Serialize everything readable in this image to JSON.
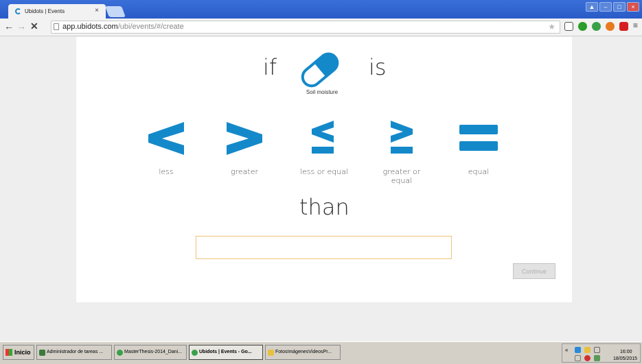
{
  "browser": {
    "tab_title": "Ubidots | Events",
    "tab_close": "×",
    "url_host": "app.ubidots.com",
    "url_path": "/ubi/events/#/create"
  },
  "event": {
    "if_word": "if",
    "is_word": "is",
    "than_word": "than",
    "sensor_label": "Soil moisture",
    "operators": [
      {
        "label": "less",
        "icon": "less-than-icon"
      },
      {
        "label": "greater",
        "icon": "greater-than-icon"
      },
      {
        "label": "less or equal",
        "icon": "less-or-equal-icon"
      },
      {
        "label": "greater or equal",
        "icon": "greater-or-equal-icon"
      },
      {
        "label": "equal",
        "icon": "equal-icon"
      }
    ],
    "value_input": "",
    "continue_label": "Continue"
  },
  "taskbar": {
    "start_label": "Inicio",
    "items": [
      "Administrador de tareas ...",
      "MasterThesis-2014_Dani...",
      "Ubidots | Events - Go...",
      "FotosImágenesVideosPr..."
    ],
    "clock_time": "16:00",
    "clock_date": "18/05/2015"
  },
  "colors": {
    "accent": "#1489ca",
    "input_border": "#f1c27a"
  }
}
